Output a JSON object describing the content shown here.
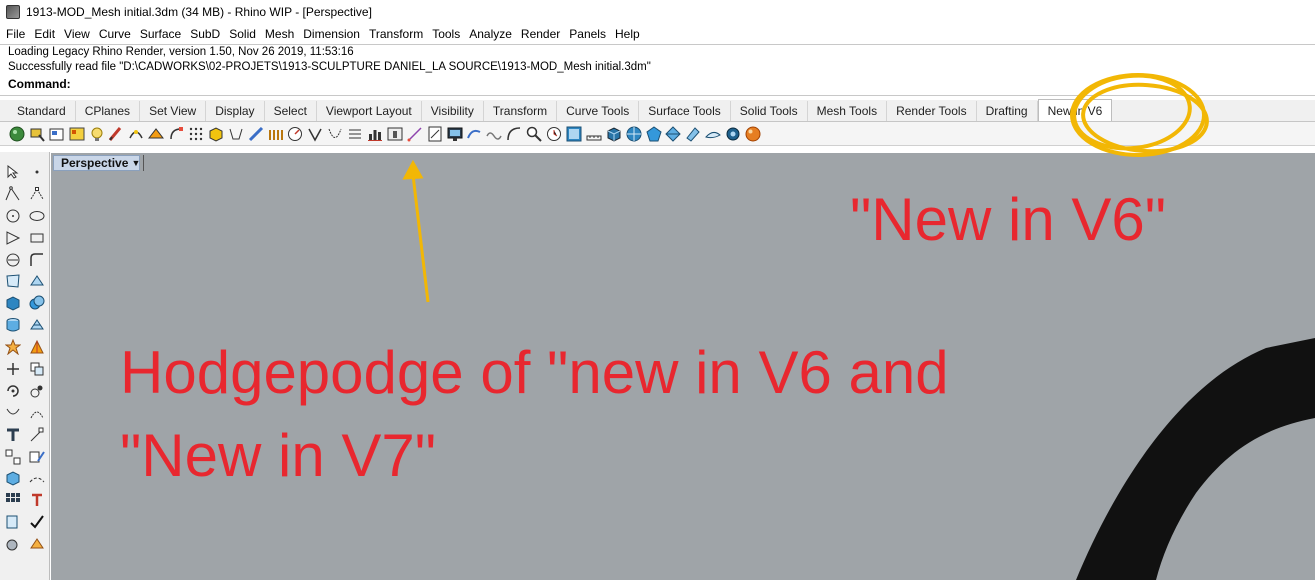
{
  "window": {
    "title": "1913-MOD_Mesh initial.3dm (34 MB) - Rhino WIP - [Perspective]"
  },
  "menu": [
    "File",
    "Edit",
    "View",
    "Curve",
    "Surface",
    "SubD",
    "Solid",
    "Mesh",
    "Dimension",
    "Transform",
    "Tools",
    "Analyze",
    "Render",
    "Panels",
    "Help"
  ],
  "command": {
    "history": [
      "Loading Legacy Rhino Render, version 1.50, Nov 26 2019, 11:53:16",
      "Successfully read file \"D:\\CADWORKS\\02-PROJETS\\1913-SCULPTURE DANIEL_LA SOURCE\\1913-MOD_Mesh initial.3dm\""
    ],
    "prompt": "Command:",
    "value": ""
  },
  "tabs": [
    {
      "label": "Standard"
    },
    {
      "label": "CPlanes"
    },
    {
      "label": "Set View"
    },
    {
      "label": "Display"
    },
    {
      "label": "Select"
    },
    {
      "label": "Viewport Layout"
    },
    {
      "label": "Visibility"
    },
    {
      "label": "Transform"
    },
    {
      "label": "Curve Tools"
    },
    {
      "label": "Surface Tools"
    },
    {
      "label": "Solid Tools"
    },
    {
      "label": "Mesh Tools"
    },
    {
      "label": "Render Tools"
    },
    {
      "label": "Drafting"
    },
    {
      "label": "New in V6",
      "active": true
    }
  ],
  "viewport": {
    "label": "Perspective"
  },
  "annotations": {
    "tab_callout": "\"New in V6\"",
    "hodgepodge_line1": "Hodgepodge of \"new in V6 and",
    "hodgepodge_line2": "\"New in V7\"",
    "color": "#e8272f",
    "highlight_color": "#f2b705"
  }
}
